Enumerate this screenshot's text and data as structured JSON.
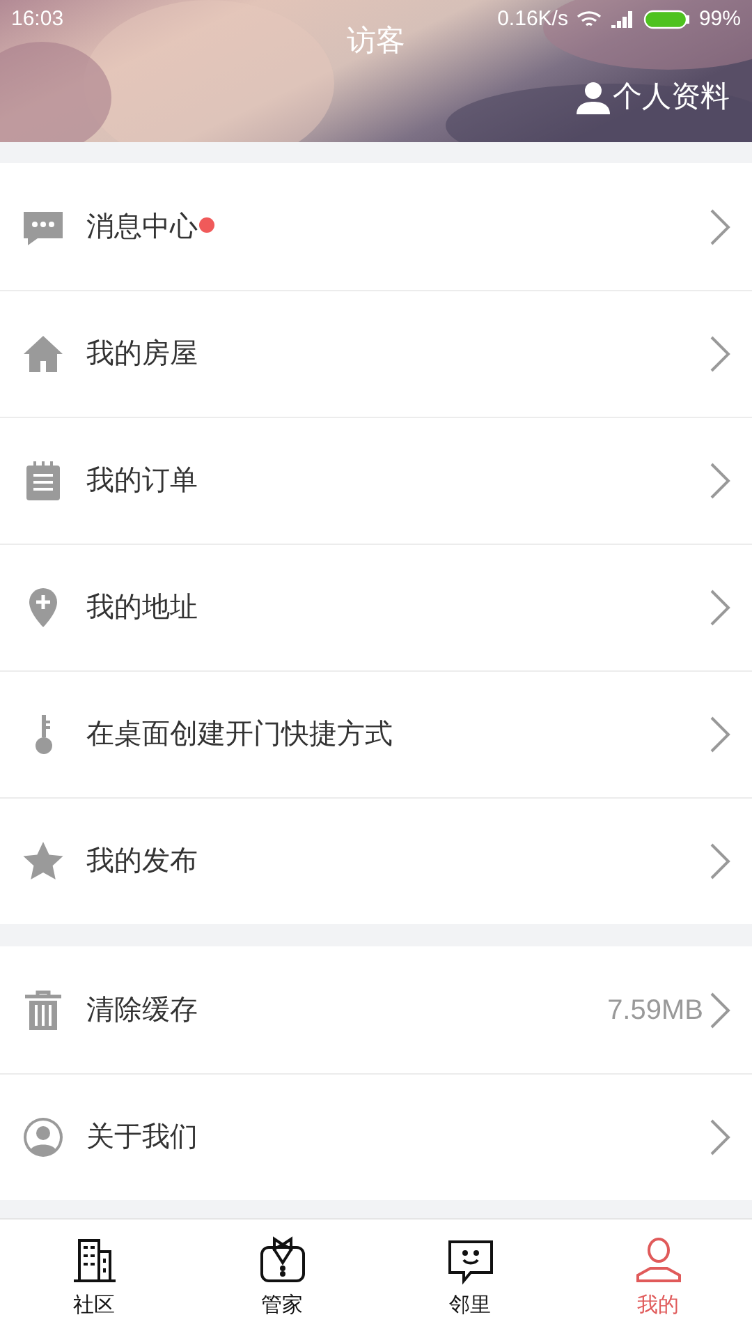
{
  "status_bar": {
    "time": "16:03",
    "speed": "0.16K/s",
    "battery": "99%"
  },
  "header": {
    "title": "访客",
    "profile_link": "个人资料"
  },
  "sections": [
    {
      "items": [
        {
          "kind": "message",
          "label": "消息中心",
          "badge": true
        },
        {
          "kind": "house",
          "label": "我的房屋",
          "badge": false
        },
        {
          "kind": "order",
          "label": "我的订单",
          "badge": false
        },
        {
          "kind": "location",
          "label": "我的地址",
          "badge": false
        },
        {
          "kind": "key",
          "label": "在桌面创建开门快捷方式",
          "badge": false
        },
        {
          "kind": "star",
          "label": "我的发布",
          "badge": false
        }
      ]
    },
    {
      "items": [
        {
          "kind": "trash",
          "label": "清除缓存",
          "value": "7.59MB",
          "badge": false
        },
        {
          "kind": "person",
          "label": "关于我们",
          "badge": false
        }
      ]
    }
  ],
  "tabs": [
    {
      "kind": "building",
      "label": "社区",
      "selected": false
    },
    {
      "kind": "butler",
      "label": "管家",
      "selected": false
    },
    {
      "kind": "chat",
      "label": "邻里",
      "selected": false
    },
    {
      "kind": "person",
      "label": "我的",
      "selected": true
    }
  ]
}
